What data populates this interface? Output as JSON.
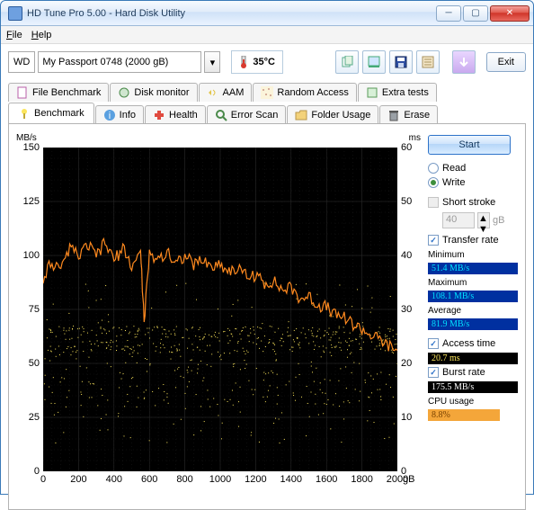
{
  "window": {
    "title": "HD Tune Pro 5.00 - Hard Disk Utility"
  },
  "menu": {
    "file": "File",
    "help": "Help"
  },
  "drive": {
    "prefix": "WD",
    "name": "My Passport 0748 (2000 gB)"
  },
  "temp": {
    "value": "35°C"
  },
  "exit": "Exit",
  "tabs_row1": [
    "File Benchmark",
    "Disk monitor",
    "AAM",
    "Random Access",
    "Extra tests"
  ],
  "tabs_row2": [
    "Benchmark",
    "Info",
    "Health",
    "Error Scan",
    "Folder Usage",
    "Erase"
  ],
  "chart": {
    "y1_unit": "MB/s",
    "y2_unit": "ms",
    "x_unit": "gB"
  },
  "chart_data": {
    "type": "line+scatter",
    "title": "",
    "xlabel": "gB",
    "ylabel_left": "MB/s",
    "ylabel_right": "ms",
    "x_range": [
      0,
      2000
    ],
    "y_left_range": [
      0,
      150
    ],
    "y_right_range": [
      0,
      60
    ],
    "x_ticks": [
      0,
      200,
      400,
      600,
      800,
      1000,
      1200,
      1400,
      1600,
      1800,
      2000
    ],
    "y_left_ticks": [
      0,
      25,
      50,
      75,
      100,
      125,
      150
    ],
    "y_right_ticks": [
      0,
      10,
      20,
      30,
      40,
      50,
      60
    ],
    "series": [
      {
        "name": "Transfer rate (write)",
        "axis": "left",
        "color": "#ff8a1f",
        "x": [
          0,
          50,
          100,
          150,
          200,
          250,
          300,
          350,
          400,
          450,
          500,
          550,
          570,
          600,
          650,
          700,
          750,
          800,
          850,
          900,
          950,
          1000,
          1050,
          1100,
          1150,
          1200,
          1250,
          1300,
          1350,
          1400,
          1450,
          1500,
          1550,
          1600,
          1650,
          1700,
          1750,
          1800,
          1850,
          1900,
          1950,
          2000
        ],
        "y": [
          90,
          97,
          92,
          104,
          99,
          105,
          100,
          106,
          98,
          103,
          95,
          102,
          70,
          100,
          99,
          101,
          97,
          100,
          96,
          98,
          95,
          96,
          93,
          94,
          90,
          91,
          87,
          88,
          84,
          85,
          80,
          81,
          77,
          76,
          72,
          72,
          68,
          66,
          63,
          61,
          58,
          56
        ]
      },
      {
        "name": "Access time",
        "axis": "right",
        "type": "scatter",
        "color": "#fbe55b",
        "note": "dense random dots; statistics av=20.7ms; band mainly 12-30ms across full x range with cluster ~22-26ms"
      }
    ]
  },
  "panel": {
    "start": "Start",
    "read": "Read",
    "write": "Write",
    "shortstroke": "Short stroke",
    "shortstroke_val": "40",
    "shortstroke_unit": "gB",
    "transfer": "Transfer rate",
    "min_lbl": "Minimum",
    "min_val": "51.4 MB/s",
    "max_lbl": "Maximum",
    "max_val": "108.1 MB/s",
    "avg_lbl": "Average",
    "avg_val": "81.9 MB/s",
    "access": "Access time",
    "access_val": "20.7 ms",
    "burst": "Burst rate",
    "burst_val": "175.5 MB/s",
    "cpu": "CPU usage",
    "cpu_val": "8.8%"
  }
}
